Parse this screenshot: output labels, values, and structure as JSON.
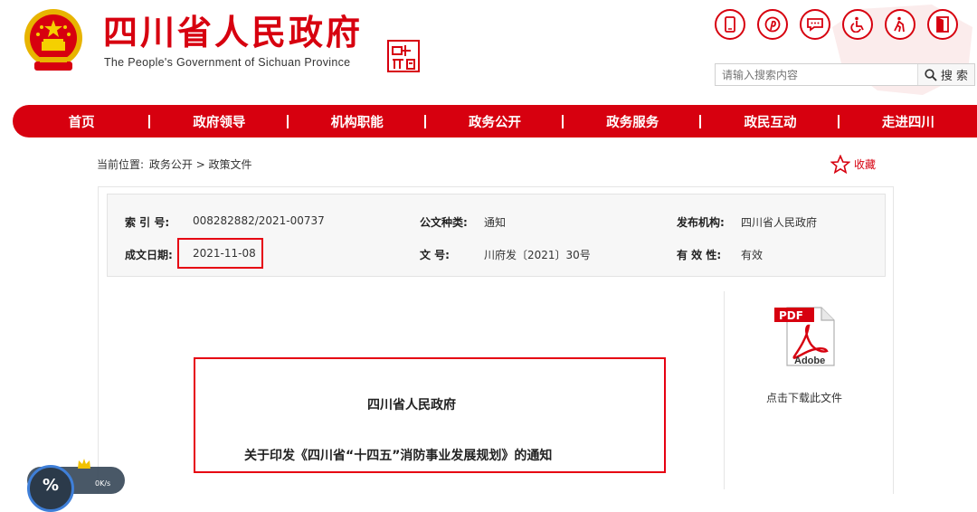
{
  "header": {
    "title": "四川省人民政府",
    "subtitle": "The People's Government of Sichuan Province",
    "tool_icons": [
      "mobile-icon",
      "pinterest-icon",
      "message-icon",
      "wheelchair-icon",
      "elderly-icon",
      "exit-icon"
    ]
  },
  "search": {
    "placeholder": "请输入搜索内容",
    "button_label": "搜 索"
  },
  "nav": {
    "items": [
      "首页",
      "政府领导",
      "机构职能",
      "政务公开",
      "政务服务",
      "政民互动",
      "走进四川"
    ]
  },
  "breadcrumb": {
    "label": "当前位置:",
    "path": "政务公开 > 政策文件"
  },
  "favorite": {
    "label": "收藏"
  },
  "meta": {
    "index_label": "索 引 号:",
    "index_value": "008282882/2021-00737",
    "type_label": "公文种类:",
    "type_value": "通知",
    "publisher_label": "发布机构:",
    "publisher_value": "四川省人民政府",
    "date_label": "成文日期:",
    "date_value": "2021-11-08",
    "doc_no_label": "文 号:",
    "doc_no_value": "川府发〔2021〕30号",
    "validity_label": "有 效 性:",
    "validity_value": "有效"
  },
  "download": {
    "pdf_label": "PDF",
    "adobe_label": "Adobe",
    "text": "点击下载此文件"
  },
  "document": {
    "org": "四川省人民政府",
    "title": "关于印发《四川省“十四五”消防事业发展规划》的通知"
  },
  "widget": {
    "percent": "%",
    "speed": "0K/s"
  },
  "colors": {
    "brand_red": "#d7000f",
    "highlight_red": "#e60012"
  }
}
